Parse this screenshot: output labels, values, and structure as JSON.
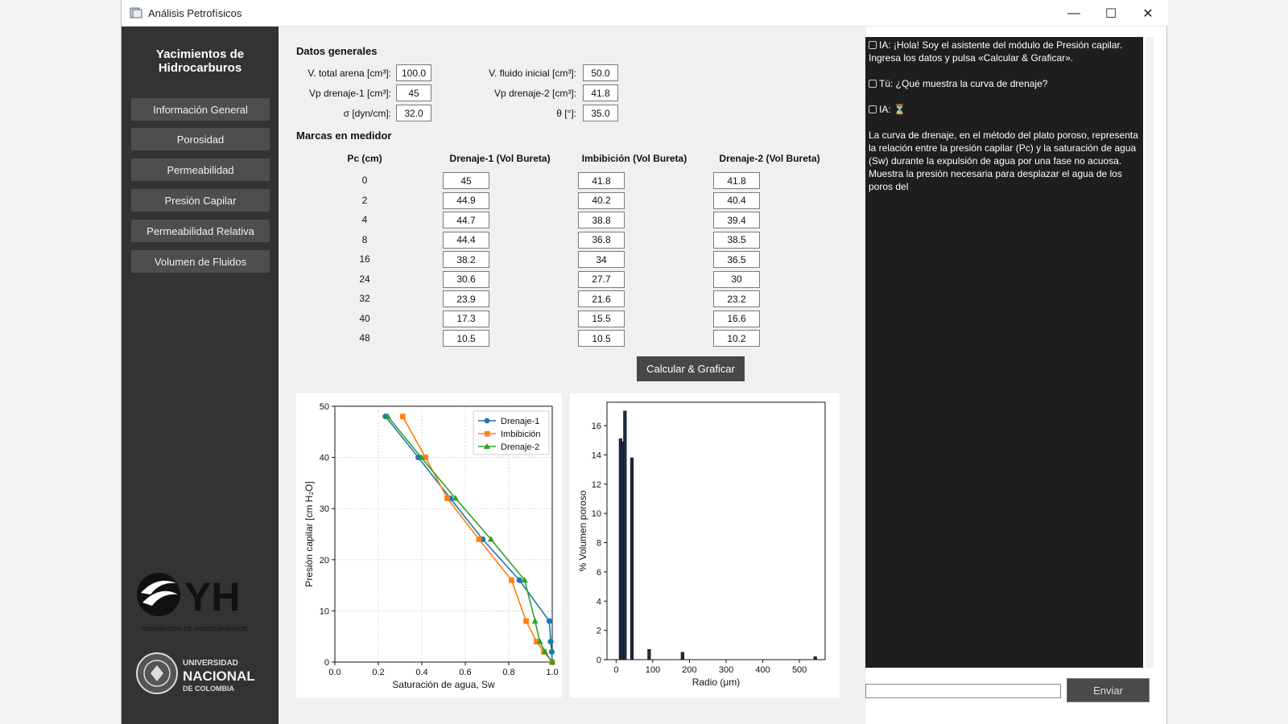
{
  "window": {
    "title": "Análisis Petrofísicos",
    "minimize": "—",
    "maximize": "☐",
    "close": "✕"
  },
  "sidebar": {
    "title_line1": "Yacimientos de",
    "title_line2": "Hidrocarburos",
    "items": [
      {
        "label": "Información General"
      },
      {
        "label": "Porosidad"
      },
      {
        "label": "Permeabilidad"
      },
      {
        "label": "Presión Capilar"
      },
      {
        "label": "Permeabilidad Relativa"
      },
      {
        "label": "Volumen de Fluidos"
      }
    ],
    "logo_yh_text": "YH",
    "logo_yh_subtitle": "YACIMIENTOS DE HIDROCARBUROS",
    "logo_un_line1": "UNIVERSIDAD",
    "logo_un_line2": "NACIONAL",
    "logo_un_line3": "DE COLOMBIA"
  },
  "general": {
    "title": "Datos generales",
    "fields": [
      {
        "label": "V. total arena [cm³]:",
        "value": "100.0"
      },
      {
        "label": "V. fluido inicial [cm³]:",
        "value": "50.0"
      },
      {
        "label": "Vp drenaje-1 [cm³]:",
        "value": "45"
      },
      {
        "label": "Vp drenaje-2 [cm³]:",
        "value": "41.8"
      },
      {
        "label": "σ [dyn/cm]:",
        "value": "32.0"
      },
      {
        "label": "θ [°]:",
        "value": "35.0"
      }
    ]
  },
  "marks": {
    "title": "Marcas en medidor",
    "headers": [
      "Pc (cm)",
      "Drenaje-1 (Vol Bureta)",
      "Imbibición (Vol Bureta)",
      "Drenaje-2 (Vol Bureta)"
    ],
    "rows": [
      {
        "pc": "0",
        "d1": "45",
        "im": "41.8",
        "d2": "41.8"
      },
      {
        "pc": "2",
        "d1": "44.9",
        "im": "40.2",
        "d2": "40.4"
      },
      {
        "pc": "4",
        "d1": "44.7",
        "im": "38.8",
        "d2": "39.4"
      },
      {
        "pc": "8",
        "d1": "44.4",
        "im": "36.8",
        "d2": "38.5"
      },
      {
        "pc": "16",
        "d1": "38.2",
        "im": "34",
        "d2": "36.5"
      },
      {
        "pc": "24",
        "d1": "30.6",
        "im": "27.7",
        "d2": "30"
      },
      {
        "pc": "32",
        "d1": "23.9",
        "im": "21.6",
        "d2": "23.2"
      },
      {
        "pc": "40",
        "d1": "17.3",
        "im": "15.5",
        "d2": "16.6"
      },
      {
        "pc": "48",
        "d1": "10.5",
        "im": "10.5",
        "d2": "10.2"
      }
    ],
    "calc_label": "Calcular & Graficar"
  },
  "chart_data": [
    {
      "type": "line",
      "xlabel": "Saturación de agua, Sw",
      "ylabel": "Presión capilar [cm H₂O]",
      "xlim": [
        0.0,
        1.0
      ],
      "ylim": [
        0,
        50
      ],
      "xticks": [
        "0.0",
        "0.2",
        "0.4",
        "0.6",
        "0.8",
        "1.0"
      ],
      "yticks": [
        "0",
        "10",
        "20",
        "30",
        "40",
        "50"
      ],
      "grid": true,
      "legend": "top-right",
      "series": [
        {
          "name": "Drenaje-1",
          "color": "#1f77b4",
          "marker": "circle",
          "x": [
            1.0,
            0.998,
            0.993,
            0.987,
            0.849,
            0.68,
            0.531,
            0.384,
            0.233
          ],
          "y": [
            0,
            2,
            4,
            8,
            16,
            24,
            32,
            40,
            48
          ]
        },
        {
          "name": "Imbibición",
          "color": "#ff7f0e",
          "marker": "square",
          "x": [
            1.0,
            0.962,
            0.928,
            0.88,
            0.813,
            0.663,
            0.517,
            0.417,
            0.312
          ],
          "y": [
            0,
            2,
            4,
            8,
            16,
            24,
            32,
            40,
            48
          ]
        },
        {
          "name": "Drenaje-2",
          "color": "#2ca02c",
          "marker": "triangle",
          "x": [
            1.0,
            0.967,
            0.943,
            0.921,
            0.873,
            0.718,
            0.555,
            0.397,
            0.244
          ],
          "y": [
            0,
            2,
            4,
            8,
            16,
            24,
            32,
            40,
            48
          ]
        }
      ]
    },
    {
      "type": "bar",
      "xlabel": "Radio (μm)",
      "ylabel": "% Volumen poroso",
      "xlim": [
        -25,
        570
      ],
      "ylim": [
        0,
        17.6
      ],
      "xticks": [
        "0",
        "100",
        "200",
        "300",
        "400",
        "500"
      ],
      "yticks": [
        "0",
        "2",
        "4",
        "6",
        "8",
        "10",
        "12",
        "14",
        "16"
      ],
      "grid": false,
      "bar_color": "#1f2a44",
      "x": [
        12,
        18,
        24,
        43,
        90,
        181,
        543
      ],
      "values": [
        15.1,
        14.9,
        17.0,
        13.8,
        0.7,
        0.5,
        0.2
      ]
    }
  ],
  "chat": {
    "messages": [
      {
        "text": "IA: ¡Hola! Soy el asistente del módulo de Presión capilar. Ingresa los datos y pulsa «Calcular & Graficar»."
      },
      {
        "text": "Tú: ¿Qué muestra la curva de drenaje?"
      },
      {
        "text": "IA: ⏳"
      },
      {
        "text": "La curva de drenaje, en el método del plato poroso, representa la relación entre la presión capilar (Pc) y la saturación de agua (Sw) durante la expulsión de agua por una fase no acuosa.  Muestra la presión necesaria para desplazar el agua de los poros del"
      }
    ],
    "input_value": "",
    "send_label": "Enviar"
  }
}
